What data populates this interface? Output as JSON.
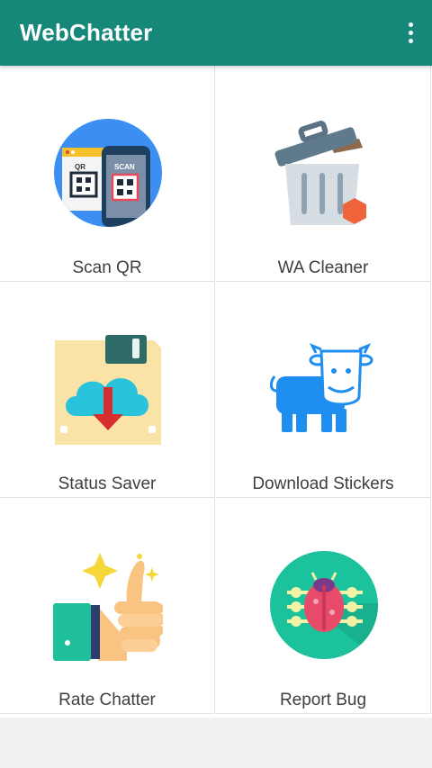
{
  "app": {
    "title": "WebChatter"
  },
  "tiles": [
    {
      "label": "Scan QR",
      "icon": "scan-qr-icon"
    },
    {
      "label": "WA Cleaner",
      "icon": "trash-can-icon"
    },
    {
      "label": "Status Saver",
      "icon": "cloud-download-icon"
    },
    {
      "label": "Download Stickers",
      "icon": "cow-icon"
    },
    {
      "label": "Rate Chatter",
      "icon": "thumbs-up-icon"
    },
    {
      "label": "Report Bug",
      "icon": "bug-icon"
    }
  ],
  "scan_icon_text": {
    "qr": "QR",
    "scan": "SCAN"
  },
  "colors": {
    "appbar": "#16887a",
    "primary_text_on_appbar": "#ffffff",
    "label": "#3f3f3f",
    "divider": "#e2e2e2"
  }
}
